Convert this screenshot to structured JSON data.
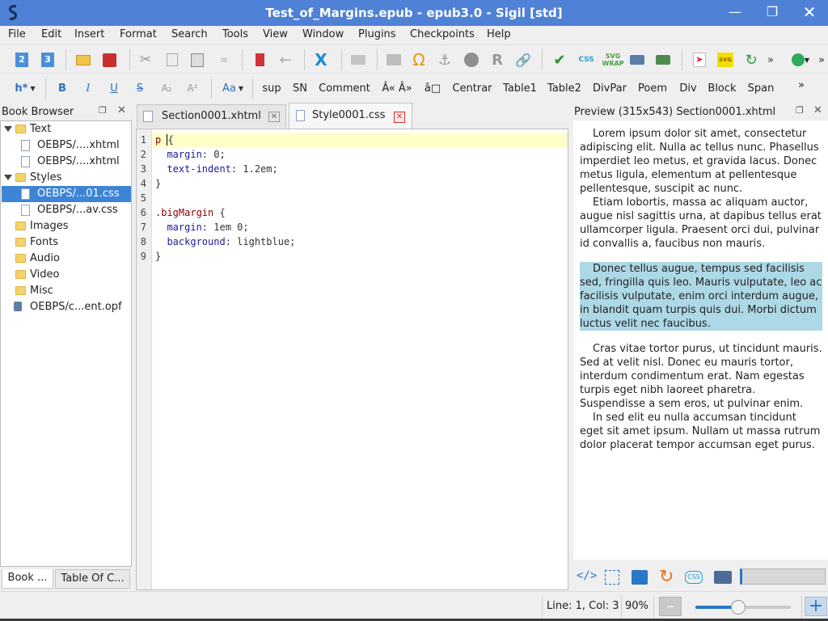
{
  "window": {
    "title": "Test_of_Margins.epub - epub3.0 - Sigil [std]",
    "minimize_icon": "minimize-icon",
    "maximize_icon": "restore-icon",
    "close_icon": "close-icon"
  },
  "menubar": {
    "items": [
      "File",
      "Edit",
      "Insert",
      "Format",
      "Search",
      "Tools",
      "View",
      "Window",
      "Plugins",
      "Checkpoints",
      "Help"
    ]
  },
  "toolbar1": {
    "icons": [
      "heading2-icon",
      "heading3-icon",
      "open-icon",
      "save-icon",
      "cut-icon",
      "copy-icon",
      "paste-icon",
      "link-disabled-icon",
      "bookmark-icon",
      "back-icon",
      "x-icon",
      "print-icon",
      "image-icon",
      "omega-icon",
      "anchor-icon",
      "accessibility-icon",
      "replace-icon",
      "link-icon",
      "checkmark-icon",
      "css-check-icon",
      "svg-wrap-icon",
      "import-icon",
      "export-icon",
      "pdf-icon",
      "svg-icon",
      "validate-icon",
      "more-icon",
      "plugin-icon",
      "overflow-icon"
    ],
    "svg_wrap_label": "SVG\nWRAP",
    "css_label": "CSS",
    "svg_label": "SVG"
  },
  "toolbar2": {
    "heading_label": "h*",
    "bold": "B",
    "italic": "I",
    "underline": "U",
    "strike": "S",
    "subscript": "A₂",
    "superscript": "A²",
    "case_label": "Aa",
    "clips": [
      "sup",
      "SN",
      "Comment",
      "Â« Â»",
      "â□",
      "Centrar",
      "Table1",
      "Table2",
      "DivPar",
      "Poem",
      "Div",
      "Block",
      "Span"
    ],
    "overflow": "»"
  },
  "book_browser": {
    "title": "Book Browser",
    "tree": [
      {
        "label": "Text",
        "type": "folder",
        "expanded": true
      },
      {
        "label": "OEBPS/....xhtml",
        "type": "xhtml"
      },
      {
        "label": "OEBPS/....xhtml",
        "type": "xhtml"
      },
      {
        "label": "Styles",
        "type": "folder",
        "expanded": true
      },
      {
        "label": "OEBPS/...01.css",
        "type": "css",
        "selected": true
      },
      {
        "label": "OEBPS/...av.css",
        "type": "css"
      },
      {
        "label": "Images",
        "type": "folder"
      },
      {
        "label": "Fonts",
        "type": "folder"
      },
      {
        "label": "Audio",
        "type": "folder"
      },
      {
        "label": "Video",
        "type": "folder"
      },
      {
        "label": "Misc",
        "type": "folder"
      },
      {
        "label": "OEBPS/c...ent.opf",
        "type": "opf"
      }
    ],
    "tabs": [
      "Book ...",
      "Table Of C..."
    ]
  },
  "editor": {
    "tabs": [
      {
        "label": "Section0001.xhtml",
        "active": false
      },
      {
        "label": "Style0001.css",
        "active": true
      }
    ],
    "line_numbers": [
      "1",
      "2",
      "3",
      "4",
      "5",
      "6",
      "7",
      "8",
      "9"
    ],
    "lines": [
      {
        "sel": "p ",
        "punc": "{",
        "prop": "",
        "val": ""
      },
      {
        "sel": "",
        "punc": "",
        "prop": "  margin",
        "val": ": 0;"
      },
      {
        "sel": "",
        "punc": "",
        "prop": "  text-indent",
        "val": ": 1.2em;"
      },
      {
        "sel": "",
        "punc": "}",
        "prop": "",
        "val": ""
      },
      {
        "sel": "",
        "punc": "",
        "prop": "",
        "val": ""
      },
      {
        "sel": ".bigMargin ",
        "punc": "{",
        "prop": "",
        "val": ""
      },
      {
        "sel": "",
        "punc": "",
        "prop": "  margin",
        "val": ": 1em 0;"
      },
      {
        "sel": "",
        "punc": "",
        "prop": "  background",
        "val": ": lightblue;"
      },
      {
        "sel": "",
        "punc": "}",
        "prop": "",
        "val": ""
      }
    ]
  },
  "preview": {
    "title": "Preview (315x543) Section0001.xhtml",
    "paragraphs": [
      "Lorem ipsum dolor sit amet, consectetur adipiscing elit. Nulla ac tellus nunc. Phasellus imperdiet leo metus, et gravida lacus. Donec metus ligula, elementum at pellentesque pellentesque, suscipit ac nunc.",
      "Etiam lobortis, massa ac aliquam auctor, augue nisl sagittis urna, at dapibus tellus erat ullamcorper ligula. Praesent orci dui, pulvinar id convallis a, faucibus non mauris.",
      "Donec tellus augue, tempus sed facilisis sed, fringilla quis leo. Mauris vulputate, leo ac facilisis vulputate, enim orci interdum augue, in blandit quam turpis quis dui. Morbi dictum luctus velit nec faucibus.",
      "Cras vitae tortor purus, ut tincidunt mauris. Sed at velit nisl. Donec eu mauris tortor, interdum condimentum erat. Nam egestas turpis eget nibh laoreet pharetra. Suspendisse a sem eros, ut pulvinar enim.",
      "In sed elit eu nulla accumsan tincidunt eget sit amet ipsum. Nullam ut massa rutrum dolor placerat tempor accumsan eget purus."
    ],
    "tool_icons": [
      "code-view-icon",
      "inspect-icon",
      "copy-page-icon",
      "reload-icon",
      "css-toggle-icon",
      "print-icon"
    ],
    "highlight_color": "#add8e6"
  },
  "statusbar": {
    "position": "Line: 1, Col: 3",
    "zoom": "90%",
    "zoom_fraction": 0.45,
    "zoom_out_icon": "minus-icon",
    "zoom_in_icon": "plus-icon"
  },
  "colors": {
    "titlebar": "#4f81d6",
    "selection": "#3d84d6",
    "current_line": "#fefeca"
  }
}
